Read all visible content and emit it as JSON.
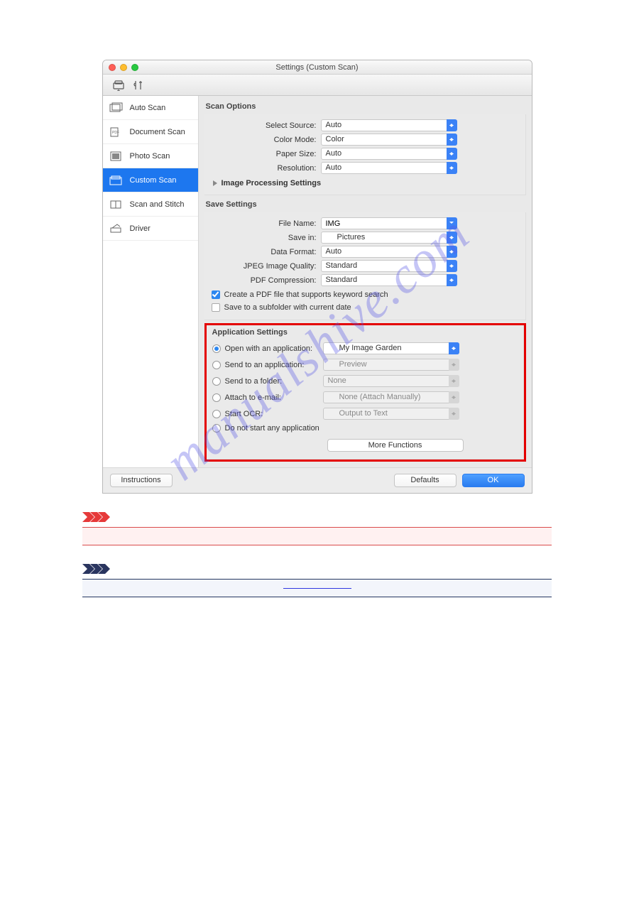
{
  "window": {
    "title": "Settings (Custom Scan)"
  },
  "sidebar": {
    "items": [
      {
        "label": "Auto Scan"
      },
      {
        "label": "Document Scan"
      },
      {
        "label": "Photo Scan"
      },
      {
        "label": "Custom Scan"
      },
      {
        "label": "Scan and Stitch"
      },
      {
        "label": "Driver"
      }
    ]
  },
  "scan_options": {
    "title": "Scan Options",
    "select_source_label": "Select Source:",
    "select_source_value": "Auto",
    "color_mode_label": "Color Mode:",
    "color_mode_value": "Color",
    "paper_size_label": "Paper Size:",
    "paper_size_value": "Auto",
    "resolution_label": "Resolution:",
    "resolution_value": "Auto",
    "image_processing": "Image Processing Settings"
  },
  "save_settings": {
    "title": "Save Settings",
    "file_name_label": "File Name:",
    "file_name_value": "IMG",
    "save_in_label": "Save in:",
    "save_in_value": "Pictures",
    "data_format_label": "Data Format:",
    "data_format_value": "Auto",
    "jpeg_quality_label": "JPEG Image Quality:",
    "jpeg_quality_value": "Standard",
    "pdf_compression_label": "PDF Compression:",
    "pdf_compression_value": "Standard",
    "keyword_pdf": "Create a PDF file that supports keyword search",
    "subfolder": "Save to a subfolder with current date"
  },
  "application_settings": {
    "title": "Application Settings",
    "open_with_label": "Open with an application:",
    "open_with_value": "My Image Garden",
    "send_app_label": "Send to an application:",
    "send_app_value": "Preview",
    "send_folder_label": "Send to a folder:",
    "send_folder_value": "None",
    "attach_email_label": "Attach to e-mail:",
    "attach_email_value": "None (Attach Manually)",
    "start_ocr_label": "Start OCR:",
    "start_ocr_value": "Output to Text",
    "do_not_start": "Do not start any application",
    "more_functions": "More Functions"
  },
  "footer": {
    "instructions": "Instructions",
    "defaults": "Defaults",
    "ok": "OK"
  },
  "watermark": "manualshive.com"
}
